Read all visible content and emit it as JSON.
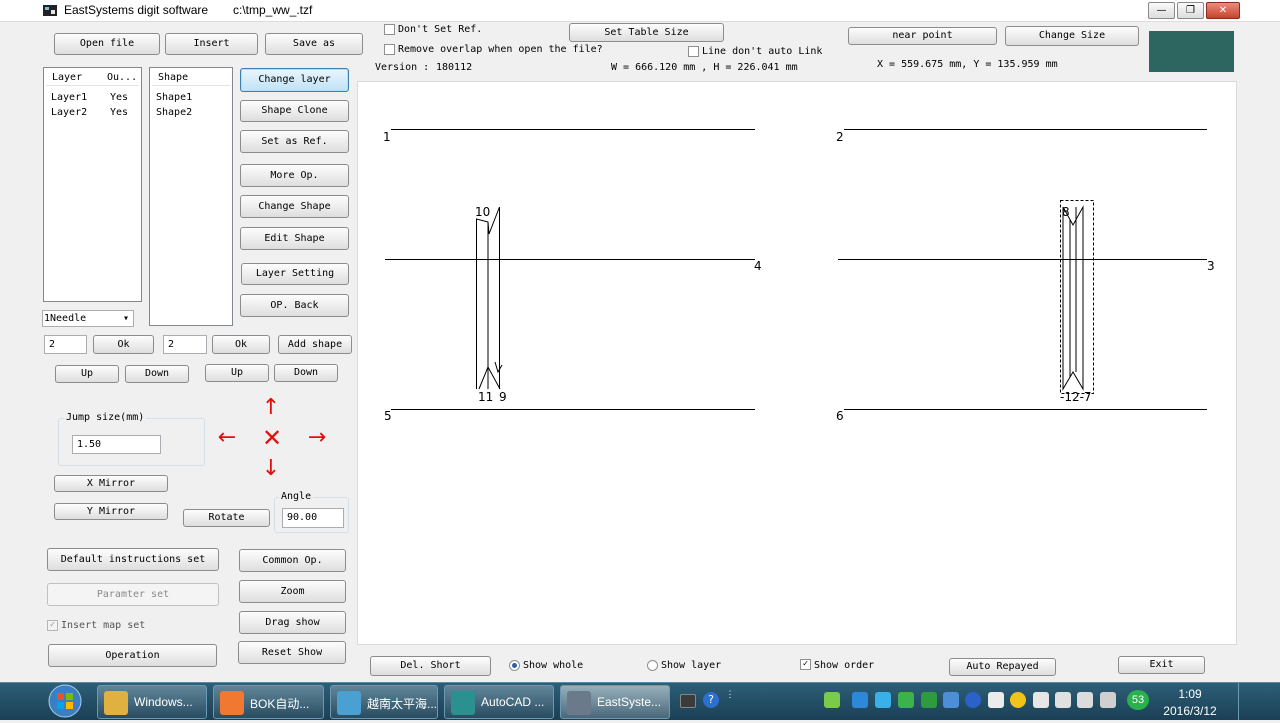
{
  "window": {
    "app_title": "EastSystems digit software",
    "file_path": "c:\\tmp_ww_.tzf",
    "controls": {
      "minimize": "—",
      "maximize": "❐",
      "close": "✕"
    }
  },
  "top": {
    "open_file": "Open file",
    "insert": "Insert",
    "save_as": "Save as",
    "dont_set_ref": "Don't Set Ref.",
    "remove_overlap": "Remove overlap when open the file?",
    "set_table_size": "Set Table Size",
    "line_dont_auto_link": "Line don't auto Link",
    "version_label": "Version :",
    "version_value": "180112",
    "size_readout": "W = 666.120 mm , H = 226.041 mm",
    "near_point": "near point",
    "change_size": "Change Size",
    "coord_readout": "X = 559.675 mm, Y = 135.959 mm",
    "color_swatch": "#2d6561"
  },
  "layers": {
    "headers": [
      "Layer",
      "Ou..."
    ],
    "rows": [
      {
        "name": "Layer1",
        "out": "Yes"
      },
      {
        "name": "Layer2",
        "out": "Yes"
      }
    ]
  },
  "shapes": {
    "header": "Shape",
    "rows": [
      "Shape1",
      "Shape2"
    ]
  },
  "side": {
    "change_layer": "Change layer",
    "shape_clone": "Shape Clone",
    "set_as_ref": "Set as Ref.",
    "more_op": "More Op.",
    "change_shape": "Change Shape",
    "edit_shape": "Edit Shape",
    "layer_setting": "Layer Setting",
    "op_back": "OP. Back"
  },
  "needle_select": "1Needle",
  "left_input": "2",
  "left_ok": "Ok",
  "right_input": "2",
  "right_ok": "Ok",
  "add_shape": "Add shape",
  "up1": "Up",
  "down1": "Down",
  "up2": "Up",
  "down2": "Down",
  "jump": {
    "label": "Jump size(mm)",
    "value": "1.50"
  },
  "arrows": {
    "up": "↑",
    "down": "↓",
    "left": "←",
    "right": "→",
    "center": "✕"
  },
  "x_mirror": "X Mirror",
  "y_mirror": "Y Mirror",
  "rotate": "Rotate",
  "angle": {
    "label": "Angle",
    "value": "90.00"
  },
  "default_instructions_set": "Default instructions set",
  "paramter_set": "Paramter set",
  "insert_map_set": "Insert map set",
  "operation": "Operation",
  "common_op": "Common Op.",
  "zoom": "Zoom",
  "drag_show": "Drag show",
  "reset_show": "Reset Show",
  "bottom": {
    "del_short": "Del. Short",
    "show_whole": "Show whole",
    "show_layer": "Show layer",
    "show_order": "Show order",
    "auto_repayed": "Auto Repayed",
    "exit": "Exit"
  },
  "canvas_labels": {
    "l1": "1",
    "l2": "2",
    "l3": "3",
    "l4": "4",
    "l5": "5",
    "l6": "6",
    "l10": "10",
    "l11": "11",
    "l9": "9",
    "l8": "8",
    "l12_7": "-12-7"
  },
  "taskbar": {
    "items": [
      {
        "label": "Windows...",
        "color": "#e0b040"
      },
      {
        "label": "BOK自动...",
        "color": "#f07830"
      },
      {
        "label": "越南太平海...",
        "color": "#4aa0d0"
      },
      {
        "label": "AutoCAD ...",
        "color": "#2a9090"
      },
      {
        "label": "EastSyste...",
        "color": "#6a7a8a"
      }
    ],
    "badge": "53",
    "time": "1:09",
    "date": "2016/3/12",
    "check": "✓"
  }
}
